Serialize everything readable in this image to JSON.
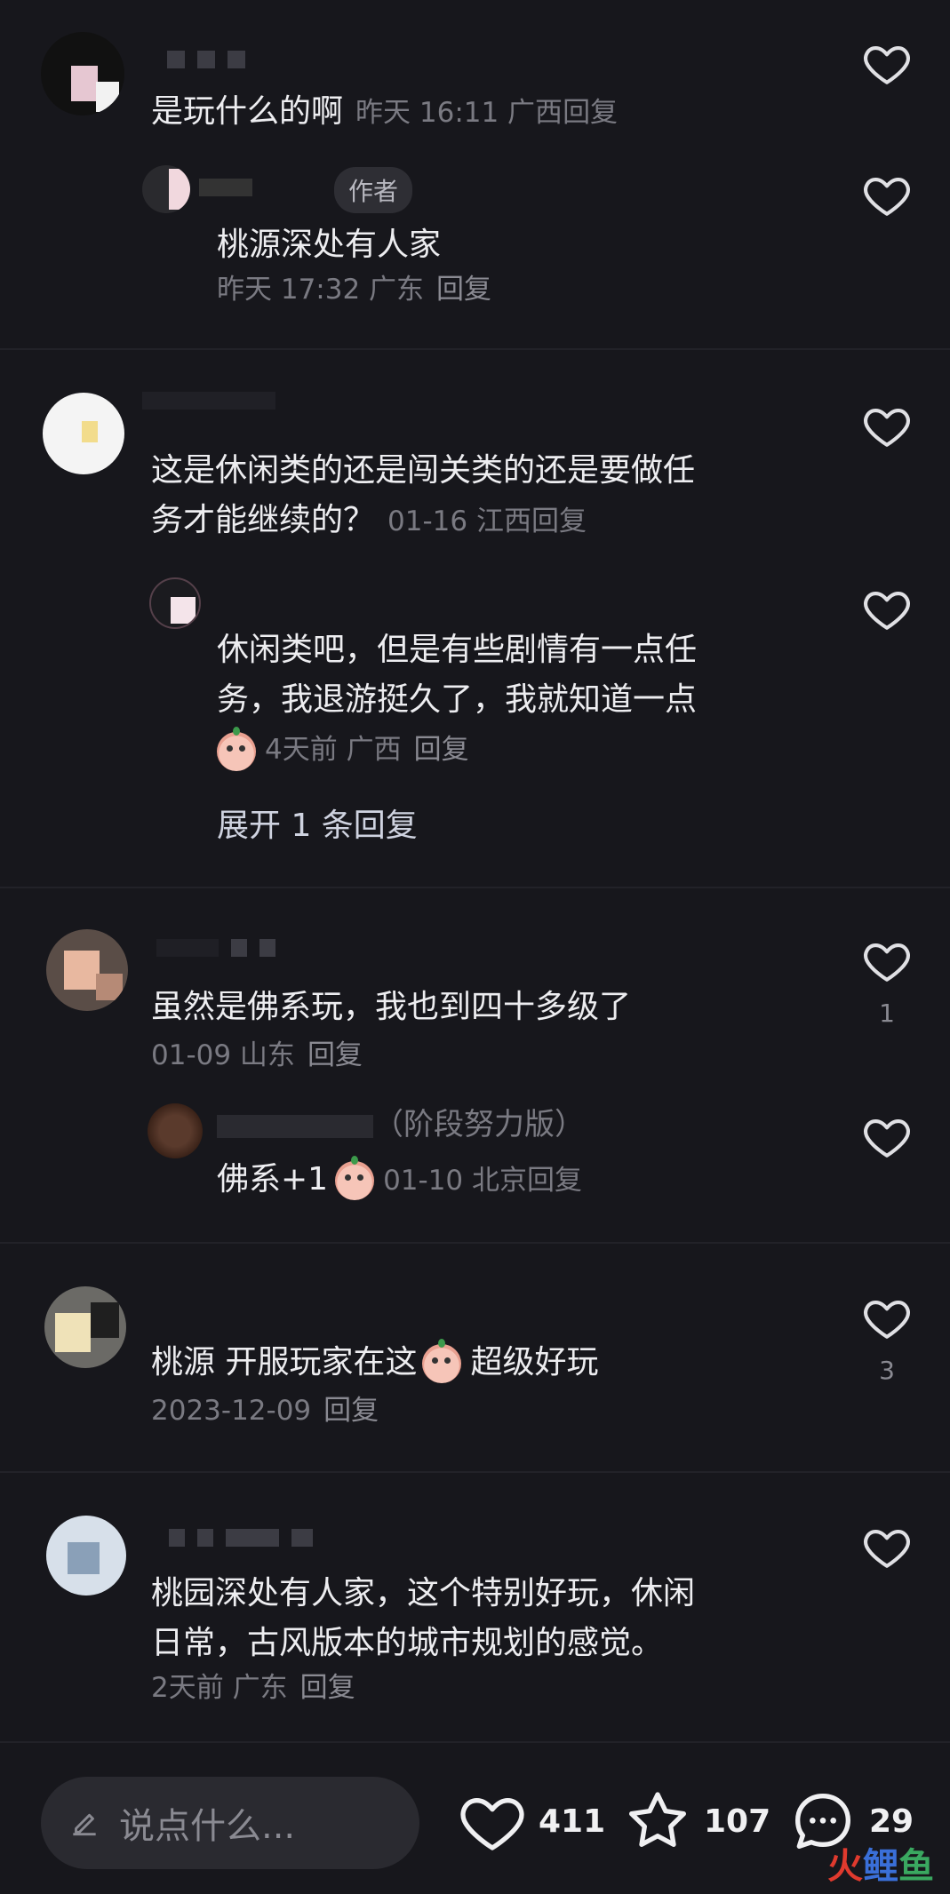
{
  "comments": [
    {
      "text": "是玩什么的啊",
      "meta": "昨天 16:11 广西",
      "reply_label": "回复",
      "replies": [
        {
          "badge": "作者",
          "text": "桃源深处有人家",
          "meta": "昨天 17:32 广东",
          "reply_label": "回复"
        }
      ]
    },
    {
      "text_lines": [
        "这是休闲类的还是闯关类的还是要做任",
        "务才能继续的？"
      ],
      "meta": "01-16 江西",
      "reply_label": "回复",
      "replies": [
        {
          "text_lines": [
            "休闲类吧，但是有些剧情有一点任",
            "务，我退游挺久了，我就知道一点"
          ],
          "meta": "4天前  广西",
          "reply_label": "回复"
        }
      ],
      "expand_label": "展开 1 条回复"
    },
    {
      "text": "虽然是佛系玩，我也到四十多级了",
      "meta": "01-09 山东",
      "reply_label": "回复",
      "like_count": "1",
      "replies": [
        {
          "name_suffix": "（阶段努力版）",
          "text": "佛系+1",
          "meta": "01-10 北京",
          "reply_label": "回复"
        }
      ]
    },
    {
      "text_before": "桃源 开服玩家在这",
      "text_after": "超级好玩",
      "meta": "2023-12-09",
      "reply_label": "回复",
      "like_count": "3"
    },
    {
      "text_lines": [
        "桃园深处有人家，这个特别好玩，休闲",
        "日常，古风版本的城市规划的感觉。"
      ],
      "meta": "2天前  广东",
      "reply_label": "回复"
    }
  ],
  "bottom_bar": {
    "placeholder": "说点什么...",
    "likes": "411",
    "favorites": "107",
    "comments": "29"
  },
  "watermark": {
    "part1": "火",
    "part2": "鲤",
    "part3": "鱼"
  },
  "colors": {
    "background": "#17171c",
    "text": "#ededf0",
    "meta": "#7a7a82",
    "expand": "#cfd3e0"
  },
  "icons": {
    "like": "heart-icon",
    "favorite": "star-icon",
    "comment": "chat-bubble-icon",
    "edit": "pencil-icon"
  }
}
